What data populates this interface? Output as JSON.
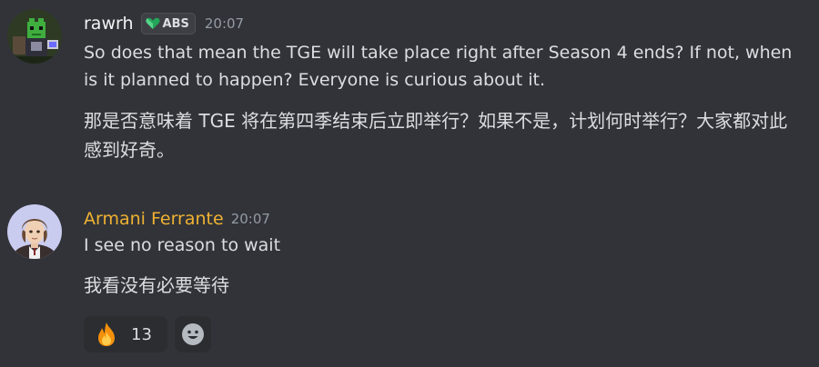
{
  "messages": [
    {
      "username": "rawrh",
      "tag": "ABS",
      "timestamp": "20:07",
      "text_en": "So does that mean the TGE will take place right after Season 4 ends? If not, when is it planned to happen? Everyone is curious about it.",
      "text_zh": "那是否意味着 TGE 将在第四季结束后立即举行？如果不是，计划何时举行？大家都对此感到好奇。",
      "avatar_icon": "pixel-frog-avatar"
    },
    {
      "username": "Armani Ferrante",
      "timestamp": "20:07",
      "text_en": "I see no reason to wait",
      "text_zh": "我看没有必要等待",
      "avatar_icon": "anime-character-avatar",
      "reactions": [
        {
          "emoji_icon": "fire-icon",
          "count": "13"
        }
      ]
    }
  ],
  "colors": {
    "background": "#313338",
    "username_highlight": "#f0b232",
    "tag_badge": "#23a559",
    "timestamp": "#949ba4"
  }
}
